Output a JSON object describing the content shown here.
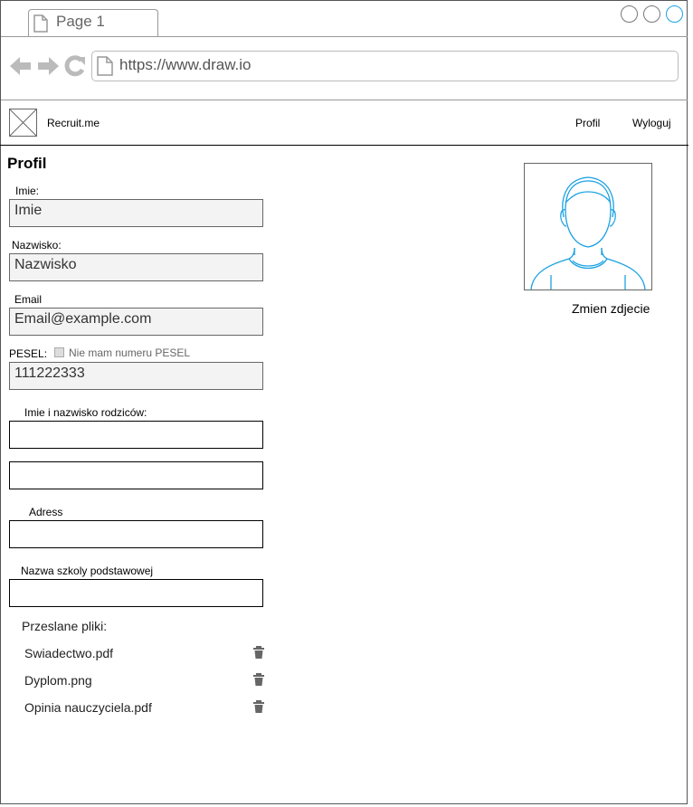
{
  "browser": {
    "tab_label": "Page 1",
    "url": "https://www.draw.io",
    "window_button_colors": [
      "#777777",
      "#777777",
      "#1ba1e2"
    ]
  },
  "navbar": {
    "brand": "Recruit.me",
    "profile_link": "Profil",
    "logout_link": "Wyloguj"
  },
  "page": {
    "title": "Profil",
    "change_photo": "Zmien zdjecie"
  },
  "form": {
    "first_name_label": "Imie:",
    "first_name_value": "Imie",
    "last_name_label": "Nazwisko:",
    "last_name_value": "Nazwisko",
    "email_label": "Email",
    "email_value": "Email@example.com",
    "pesel_label": "PESEL:",
    "no_pesel_checkbox_label": "Nie mam numeru PESEL",
    "no_pesel_checked": false,
    "pesel_value": "111222333",
    "parents_label": "Imie i nazwisko rodziców:",
    "parent1_value": "",
    "parent2_value": "",
    "address_label": "Adress",
    "address_value": "",
    "school_label": "Nazwa szkoly podstawowej",
    "school_value": ""
  },
  "files": {
    "heading": "Przeslane pliki:",
    "items": [
      {
        "name": "Swiadectwo.pdf",
        "icon": "trash-icon"
      },
      {
        "name": "Dyplom.png",
        "icon": "trash-icon"
      },
      {
        "name": "Opinia nauczyciela.pdf",
        "icon": "trash-icon"
      }
    ]
  },
  "colors": {
    "avatar_stroke": "#1ba1e2",
    "field_fill": "#f3f3f3",
    "border": "#666666"
  }
}
